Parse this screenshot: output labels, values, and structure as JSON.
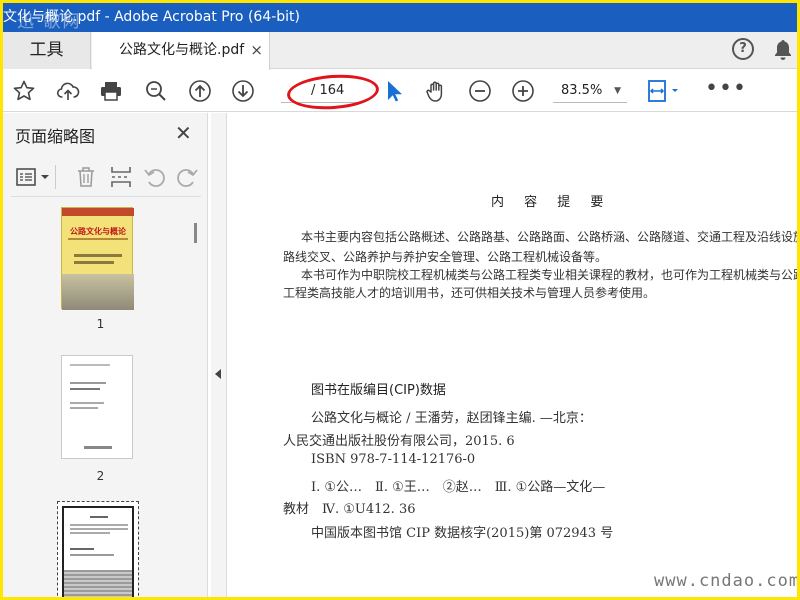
{
  "window": {
    "title": "文化与概论.pdf - Adobe Acrobat Pro (64-bit)",
    "watermark_top": "迅·歌网"
  },
  "tabs": {
    "tools_label": "工具",
    "doc_label": "公路文化与概论.pdf",
    "close_glyph": "×",
    "help_glyph": "?"
  },
  "toolbar": {
    "page_total": "/ 164",
    "zoom": "83.5%",
    "zoom_caret": "▼",
    "more": "•••"
  },
  "sidebar": {
    "title": "页面缩略图",
    "close_glyph": "✕",
    "thumbnails": [
      {
        "label": "1",
        "cover_title": "公路文化与概论"
      },
      {
        "label": "2"
      },
      {
        "label": ""
      }
    ]
  },
  "document": {
    "heading": "内 容 提 要",
    "para1_line1": "本书主要内容包括公路概述、公路路基、公路路面、公路桥涵、公路隧道、交通工程及沿线设施、公路",
    "para1_line2": "路线交叉、公路养护与养护安全管理、公路工程机械设备等。",
    "para2_line1": "本书可作为中职院校工程机械类与公路工程类专业相关课程的教材，也可作为工程机械类与公路",
    "para2_line2": "工程类高技能人才的培训用书，还可供相关技术与管理人员参考使用。",
    "cip_title": "图书在版编目(CIP)数据",
    "cip_line1": "公路文化与概论 / 王潘劳，赵团锋主编. —北京：",
    "cip_line2": "人民交通出版社股份有限公司，2015. 6",
    "cip_line3": "ISBN 978-7-114-12176-0",
    "cip_line4": "Ⅰ. ①公…　Ⅱ. ①王…　②赵…　Ⅲ. ①公路—文化—",
    "cip_line5": "教材　Ⅳ. ①U412. 36",
    "cip_line6": "中国版本图书馆 CIP 数据核字(2015)第 072943 号",
    "watermark_bottom": "www.cndao.com"
  },
  "colors": {
    "frame": "#ffe600",
    "titlebar": "#1a5ebf",
    "annotation_oval": "#e0141b",
    "select_tool": "#1a6fd4"
  }
}
